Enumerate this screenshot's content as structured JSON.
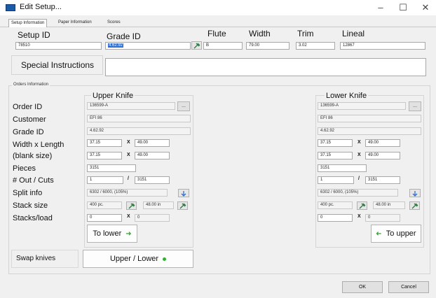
{
  "window": {
    "title": "Edit Setup...",
    "minimize_glyph": "–",
    "maximize_glyph": "☐",
    "close_glyph": "✕"
  },
  "tabs": [
    {
      "label": "Setup Information",
      "active": true
    },
    {
      "label": "Paper Information",
      "active": false
    },
    {
      "label": "Scores",
      "active": false
    }
  ],
  "header": {
    "setup_id": {
      "label": "Setup ID",
      "value": "78510"
    },
    "grade_id": {
      "label": "Grade ID",
      "value": "4.62.92"
    },
    "flute": {
      "label": "Flute",
      "value": "B"
    },
    "width": {
      "label": "Width",
      "value": "79.00"
    },
    "trim": {
      "label": "Trim",
      "value": "3.02"
    },
    "lineal": {
      "label": "Lineal",
      "value": "12867"
    },
    "special_instructions": {
      "label": "Special Instructions",
      "value": ""
    }
  },
  "orders": {
    "section_label": "Orders Information",
    "row_labels": {
      "order_id": "Order ID",
      "customer": "Customer",
      "grade_id": "Grade ID",
      "width_length": "Width x Length",
      "blank_size": "(blank size)",
      "pieces": "Pieces",
      "out_cuts": "# Out / Cuts",
      "split_info": "Split info",
      "stack_size": "Stack size",
      "stacks_load": "Stacks/load"
    },
    "upper": {
      "title": "Upper Knife",
      "order_id": "136599-A",
      "customer": "EFI      86",
      "grade_id": "4.62.92",
      "width": "37.15",
      "length": "49.00",
      "blank_width": "37.15",
      "blank_length": "49.00",
      "pieces": "3151",
      "out": "1",
      "cuts": "3151",
      "split_info": "6302 / 6000, (105%)",
      "stack_size": "400 pc.",
      "stack_height": "48.00 in",
      "stacks": "0",
      "stacks_extra": "0",
      "move_button": "To lower"
    },
    "lower": {
      "title": "Lower Knife",
      "order_id": "136599-A",
      "customer": "EFI      86",
      "grade_id": "4.62.92",
      "width": "37.15",
      "length": "49.00",
      "blank_width": "37.15",
      "blank_length": "49.00",
      "pieces": "3151",
      "out": "1",
      "cuts": "3151",
      "split_info": "6302 / 6000, (105%)",
      "stack_size": "400 pc.",
      "stack_height": "48.00 in",
      "stacks": "0",
      "stacks_extra": "0",
      "move_button": "To upper"
    },
    "x_label": "X",
    "slash_label": "/",
    "dots_label": "..."
  },
  "swap": {
    "label": "Swap knives",
    "button": "Upper / Lower"
  },
  "footer": {
    "ok": "OK",
    "cancel": "Cancel"
  },
  "colors": {
    "arrow_green": "#2fa52f",
    "picker_icon": "#2b7a3f",
    "selection_blue": "#2a6fd6"
  }
}
